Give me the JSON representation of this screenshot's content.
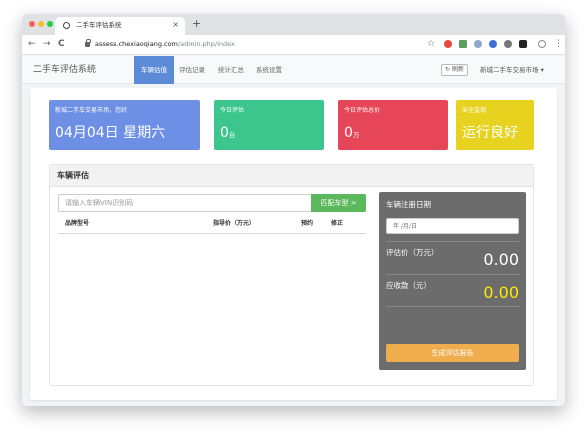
{
  "browser": {
    "tab_title": "二手车评估系统",
    "tab_close": "×",
    "new_tab": "+",
    "url_domain": "assess.chexiaoqiang.com",
    "url_path": "/admin.php/index",
    "nav_back": "←",
    "nav_forward": "→",
    "nav_reload": "C",
    "bookmark": "☆",
    "menu": "⋮"
  },
  "app": {
    "brand": "二手车评估系统",
    "nav": [
      {
        "label": "车辆估值"
      },
      {
        "label": "评估记录"
      },
      {
        "label": "统计汇总"
      },
      {
        "label": "系统设置"
      }
    ],
    "refresh_label": "刷新",
    "refresh_icon": "↻",
    "user_menu": "新城二手车交易市场 ▾"
  },
  "stats": [
    {
      "label": "新城二手车交易市场，您好",
      "value": "04月04日 星期六",
      "unit": "",
      "color": "#6e8fe6"
    },
    {
      "label": "今日评估",
      "value": "0",
      "unit": "台",
      "color": "#3cc68e"
    },
    {
      "label": "今日评估总价",
      "value": "0",
      "unit": "万",
      "color": "#e64657"
    },
    {
      "label": "安全监测",
      "value": "运行良好",
      "unit": "",
      "color": "#e6d21f"
    }
  ],
  "panel": {
    "title": "车辆评估",
    "vin_placeholder": "请输入车辆VIN识别码",
    "vin_value": "",
    "match_button": "匹配车型 >",
    "table_headers": [
      "品牌型号",
      "指导价（万元）",
      "预约",
      "修正"
    ]
  },
  "evaluation": {
    "date_title": "车辆注册日期",
    "date_placeholder": "年 /月/日",
    "price_label": "评估价（万元）",
    "price_value": "0.00",
    "receivable_label": "应收款（元）",
    "receivable_value": "0.00",
    "report_button": "生成评估报告",
    "price_color": "#ffffff",
    "receivable_color": "#ffea00"
  }
}
